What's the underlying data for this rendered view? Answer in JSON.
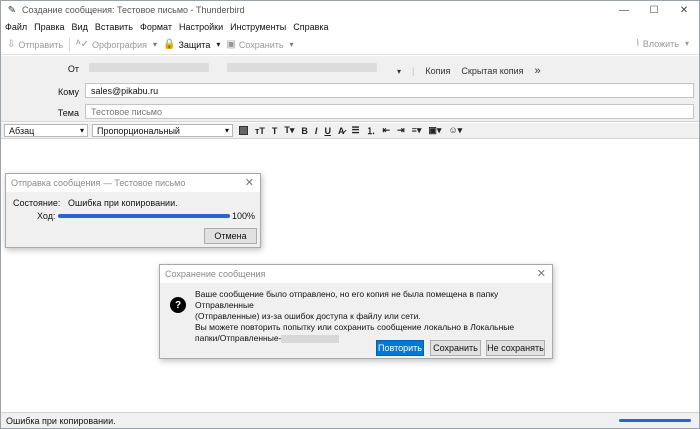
{
  "window": {
    "title": "Создание сообщения: Тестовое письмо - Thunderbird",
    "controls": {
      "minimize": "—",
      "maximize": "☐",
      "close": "✕"
    }
  },
  "menu": {
    "file": "Файл",
    "edit": "Правка",
    "view": "Вид",
    "insert": "Вставить",
    "format": "Формат",
    "settings": "Настройки",
    "tools": "Инструменты",
    "help": "Справка"
  },
  "toolbar": {
    "send": "Отправить",
    "spelling": "Орфография",
    "security": "Защита",
    "save": "Сохранить",
    "attach": "Вложить"
  },
  "headers": {
    "from_label": "От",
    "to_label": "Кому",
    "to_value": "sales@pikabu.ru",
    "subject_label": "Тема",
    "subject_value": "Тестовое письмо",
    "cc": "Копия",
    "bcc": "Скрытая копия",
    "more": "»"
  },
  "format_bar": {
    "paragraph": "Абзац",
    "font": "Пропорциональный",
    "buttons": [
      "ꟻT",
      "T",
      "T",
      "B",
      "I",
      "U",
      "A",
      "≔",
      "⋮≡",
      "⇤",
      "⇥",
      "≡",
      "▣",
      "☺"
    ]
  },
  "send_dialog": {
    "title": "Отправка сообщения — Тестовое письмо",
    "status_label": "Состояние:",
    "status_value": "Ошибка при копировании.",
    "progress_label": "Ход:",
    "progress_value": 1.0,
    "progress_text": "100%",
    "cancel": "Отмена"
  },
  "save_dialog": {
    "title": "Сохранение сообщения",
    "line1": "Ваше сообщение было отправлено, но его копия не была помещена в папку Отправленные",
    "line2": "(Отправленные) из-за ошибок доступа к файлу или сети.",
    "line3": "Вы можете повторить попытку или сохранить сообщение локально в Локальные",
    "line4": "папки/Отправленные-",
    "retry": "Повторить",
    "save": "Сохранить",
    "dont_save": "Не сохранять"
  },
  "status_bar": {
    "text": "Ошибка при копировании.",
    "progress_value": 1.0
  }
}
